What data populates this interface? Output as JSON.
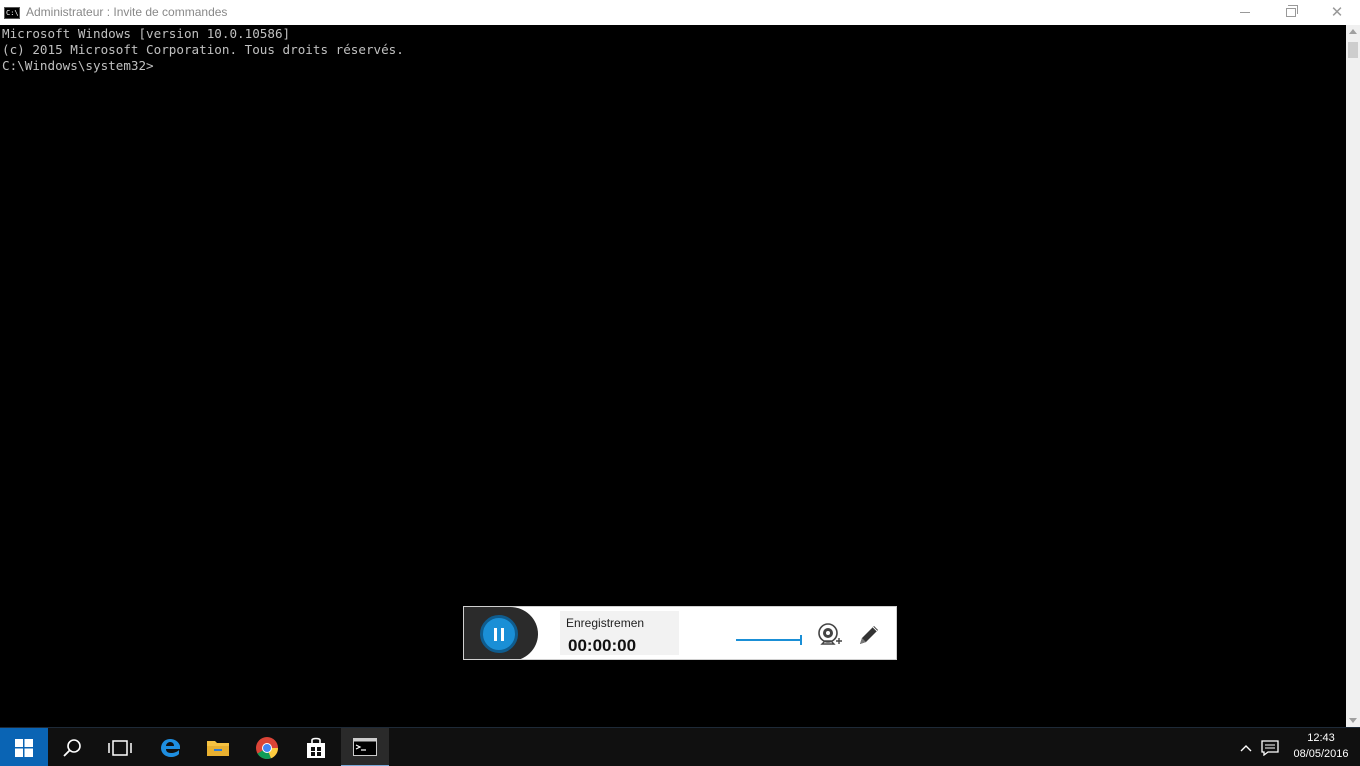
{
  "window": {
    "title": "Administrateur : Invite de commandes"
  },
  "console": {
    "lines": [
      "Microsoft Windows [version 10.0.10586]",
      "(c) 2015 Microsoft Corporation. Tous droits réservés.",
      "",
      "C:\\Windows\\system32>"
    ]
  },
  "recorder": {
    "label": "Enregistremen",
    "time": "00:00:00",
    "accent_color": "#1a8fd6"
  },
  "taskbar": {
    "apps": [
      "start",
      "search",
      "task-view",
      "edge",
      "file-explorer",
      "chrome",
      "store",
      "command-prompt"
    ],
    "clock_time": "12:43",
    "clock_date": "08/05/2016"
  }
}
